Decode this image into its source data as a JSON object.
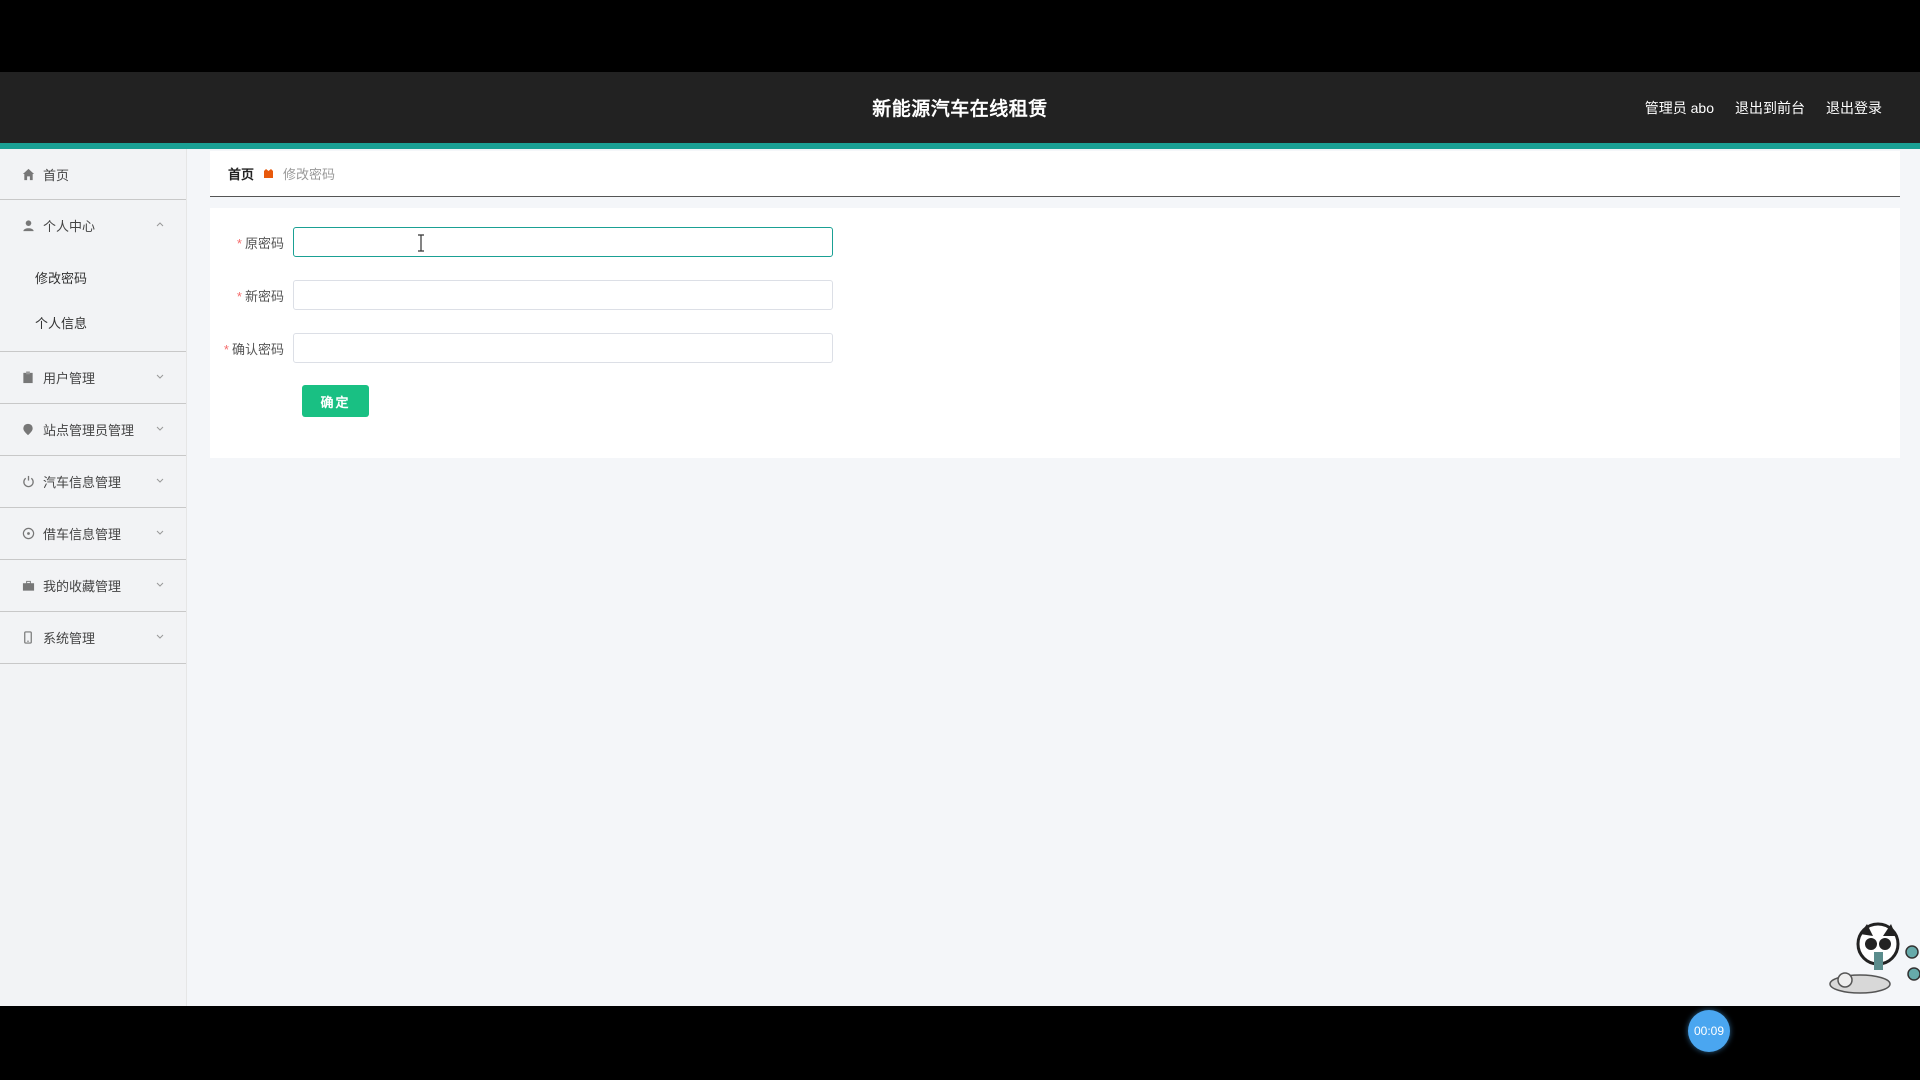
{
  "header": {
    "title": "新能源汽车在线租赁",
    "user": "管理员 abo",
    "to_front": "退出到前台",
    "logout": "退出登录"
  },
  "sidebar": {
    "home": "首页",
    "personal_center": "个人中心",
    "personal_sub": [
      "修改密码",
      "个人信息"
    ],
    "items": [
      "用户管理",
      "站点管理员管理",
      "汽车信息管理",
      "借车信息管理",
      "我的收藏管理",
      "系统管理"
    ]
  },
  "breadcrumb": {
    "home": "首页",
    "current": "修改密码"
  },
  "form": {
    "old_password_label": "原密码",
    "new_password_label": "新密码",
    "confirm_password_label": "确认密码",
    "required_mark": "*",
    "old_password_value": "",
    "new_password_value": "",
    "confirm_password_value": "",
    "submit": "确定"
  },
  "timer": "00:09",
  "colors": {
    "accent": "#1aa094",
    "button": "#19c083",
    "header": "#222222",
    "timer": "#4aa6f0"
  }
}
